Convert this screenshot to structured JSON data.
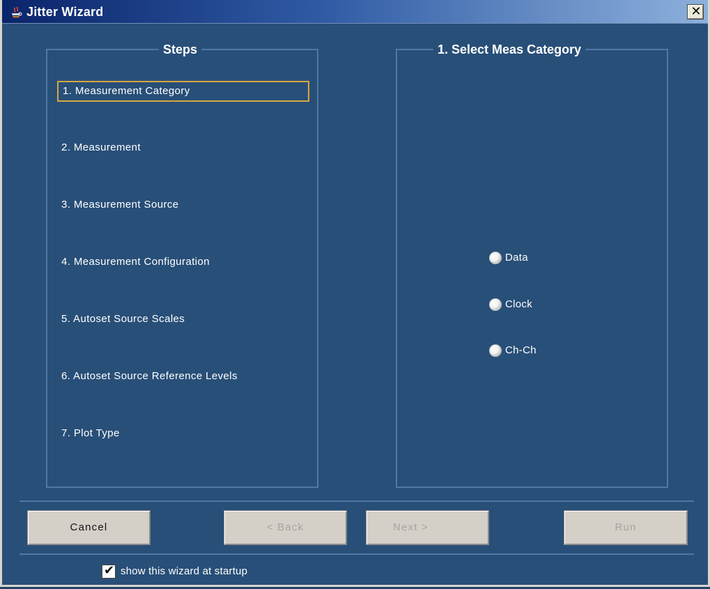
{
  "window": {
    "title": "Jitter Wizard",
    "close_symbol": "✕",
    "title_icon": "java-coffee-icon",
    "close_icon": "close-icon"
  },
  "steps_panel": {
    "title": "Steps",
    "items": [
      {
        "label": "1. Measurement Category",
        "active": true
      },
      {
        "label": "2. Measurement",
        "active": false
      },
      {
        "label": "3. Measurement Source",
        "active": false
      },
      {
        "label": "4. Measurement Configuration",
        "active": false
      },
      {
        "label": "5. Autoset Source Scales",
        "active": false
      },
      {
        "label": "6. Autoset Source Reference Levels",
        "active": false
      },
      {
        "label": "7. Plot Type",
        "active": false
      }
    ]
  },
  "category_panel": {
    "title": "1. Select Meas Category",
    "options": [
      {
        "label": "Data"
      },
      {
        "label": "Clock"
      },
      {
        "label": "Ch-Ch"
      }
    ]
  },
  "buttons": {
    "cancel": "Cancel",
    "back": "< Back",
    "next": "Next >",
    "run": "Run"
  },
  "startup": {
    "checked": true,
    "label": "show this wizard at startup",
    "check_symbol": "✔",
    "check_icon": "checkmark-icon"
  },
  "colors": {
    "background": "#284f78",
    "panel_border": "#4f78a6",
    "active_step_border": "#d9a640",
    "button_face": "#d4d0c8",
    "disabled_text": "#a7a49f"
  }
}
